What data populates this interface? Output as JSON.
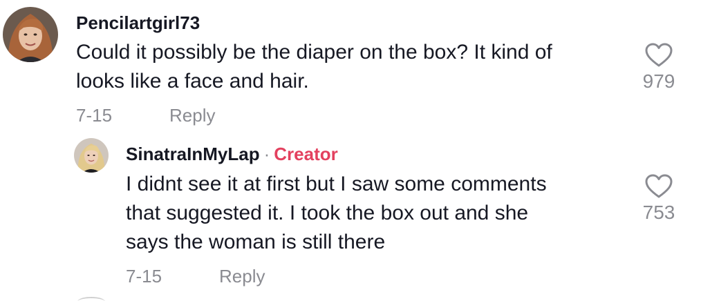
{
  "comments": {
    "main": {
      "username": "Pencilartgirl73",
      "text_lines": [
        "Could it possibly be the diaper on the box? It kind of",
        "looks like a face and hair."
      ],
      "date": "7-15",
      "reply_label": "Reply",
      "like_count": "979",
      "like_icon": "heart-outline-icon"
    },
    "reply": {
      "username": "SinatraInMyLap",
      "separator": "·",
      "badge": "Creator",
      "text_lines": [
        "I didnt see it at first but I saw some comments",
        "that suggested it. I took the box out and she",
        "says the woman is still there"
      ],
      "date": "7-15",
      "reply_label": "Reply",
      "like_count": "753",
      "like_icon": "heart-outline-icon"
    }
  },
  "colors": {
    "text": "#161823",
    "muted": "#8a8b91",
    "creator_badge": "#e3415f",
    "background": "#ffffff"
  }
}
